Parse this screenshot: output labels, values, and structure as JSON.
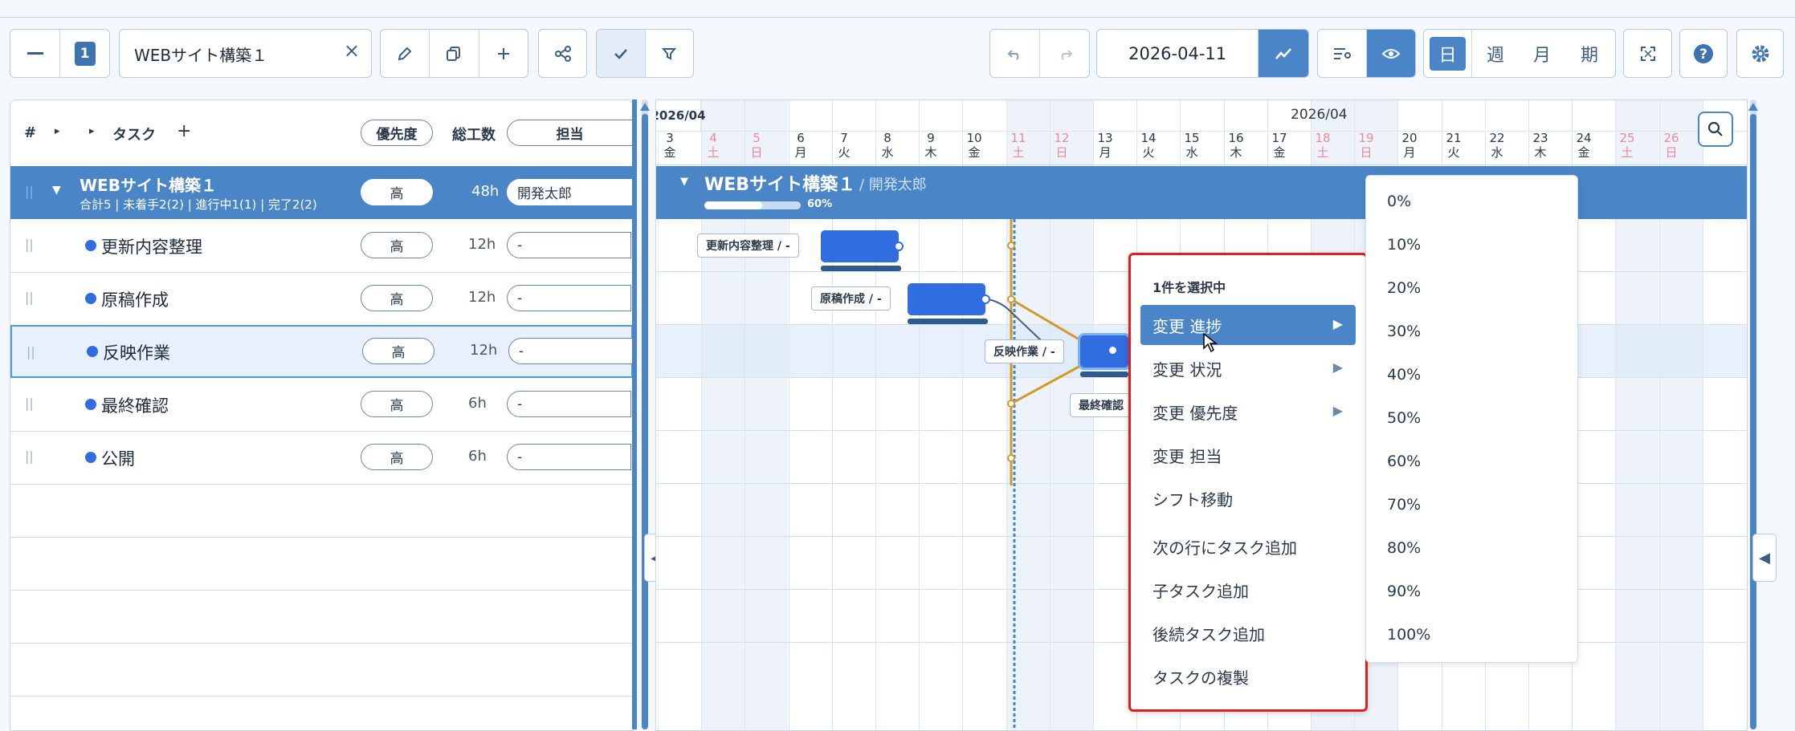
{
  "toolbar": {
    "level_badge": "1",
    "project_select": "WEBサイト構築１",
    "clear_symbol": "×",
    "date_value": "2026-04-11",
    "views": [
      "日",
      "週",
      "月",
      "期"
    ],
    "active_view": "日"
  },
  "table": {
    "headers": {
      "num": "#",
      "task": "タスク",
      "priority": "優先度",
      "hours": "総工数",
      "assignee": "担当"
    },
    "project": {
      "name": "WEBサイト構築１",
      "summary": "合計5 | 未着手2(2) | 進行中1(1) | 完了2(2)",
      "priority": "高",
      "hours": "48h",
      "assignee": "開発太郎"
    },
    "rows": [
      {
        "name": "更新内容整理",
        "priority": "高",
        "hours": "12h",
        "assignee": "-"
      },
      {
        "name": "原稿作成",
        "priority": "高",
        "hours": "12h",
        "assignee": "-"
      },
      {
        "name": "反映作業",
        "priority": "高",
        "hours": "12h",
        "assignee": "-"
      },
      {
        "name": "最終確認",
        "priority": "高",
        "hours": "6h",
        "assignee": "-"
      },
      {
        "name": "公開",
        "priority": "高",
        "hours": "6h",
        "assignee": "-"
      }
    ]
  },
  "gantt": {
    "month_left": "2026/04",
    "month_center": "2026/04",
    "project_title": "WEBサイト構築１",
    "project_owner": "/ 開発太郎",
    "project_progress": "60%",
    "project_progress_value": 0.6,
    "days": [
      {
        "d": "3",
        "w": "金"
      },
      {
        "d": "4",
        "w": "土"
      },
      {
        "d": "5",
        "w": "日"
      },
      {
        "d": "6",
        "w": "月"
      },
      {
        "d": "7",
        "w": "火"
      },
      {
        "d": "8",
        "w": "水"
      },
      {
        "d": "9",
        "w": "木"
      },
      {
        "d": "10",
        "w": "金"
      },
      {
        "d": "11",
        "w": "土"
      },
      {
        "d": "12",
        "w": "日"
      },
      {
        "d": "13",
        "w": "月"
      },
      {
        "d": "14",
        "w": "火"
      },
      {
        "d": "15",
        "w": "水"
      },
      {
        "d": "16",
        "w": "木"
      },
      {
        "d": "17",
        "w": "金"
      },
      {
        "d": "18",
        "w": "土"
      },
      {
        "d": "19",
        "w": "日"
      },
      {
        "d": "20",
        "w": "月"
      },
      {
        "d": "21",
        "w": "火"
      },
      {
        "d": "22",
        "w": "水"
      },
      {
        "d": "23",
        "w": "木"
      },
      {
        "d": "24",
        "w": "金"
      },
      {
        "d": "25",
        "w": "土"
      },
      {
        "d": "26",
        "w": "日"
      },
      {
        "d": "",
        "w": "月"
      }
    ],
    "bar_labels": [
      "更新内容整理 / -",
      "原稿作成 / -",
      "反映作業 / -",
      "最終確認"
    ]
  },
  "context_menu": {
    "header": "1件を選択中",
    "items": [
      "変更 進捗",
      "変更 状況",
      "変更 優先度",
      "変更 担当",
      "シフト移動",
      "次の行にタスク追加",
      "子タスク追加",
      "後続タスク追加",
      "タスクの複製"
    ]
  },
  "progress_submenu": [
    "0%",
    "10%",
    "20%",
    "30%",
    "40%",
    "50%",
    "60%",
    "70%",
    "80%",
    "90%",
    "100%"
  ]
}
